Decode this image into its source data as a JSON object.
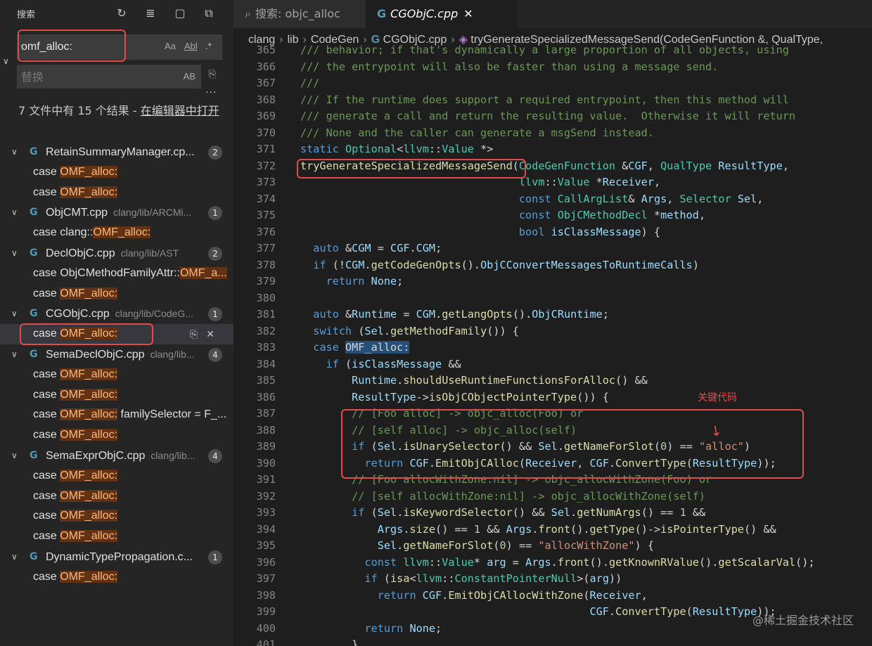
{
  "sidebar": {
    "title": "搜索",
    "search": {
      "value": "omf_alloc:",
      "opt_case": "Aa",
      "opt_word": "Abl",
      "opt_regex": ".*"
    },
    "replace": {
      "placeholder": "替换",
      "opt_preserve": "AB"
    },
    "summary": {
      "text": "7 文件中有 15 个结果 - ",
      "link": "在编辑器中打开"
    },
    "files": [
      {
        "name": "RetainSummaryManager.cp...",
        "path": "",
        "count": "2",
        "matches": [
          {
            "pre": "case ",
            "hit": "OMF_alloc:",
            "post": ""
          },
          {
            "pre": "case ",
            "hit": "OMF_alloc:",
            "post": ""
          }
        ]
      },
      {
        "name": "ObjCMT.cpp",
        "path": "clang/lib/ARCMi...",
        "count": "1",
        "matches": [
          {
            "pre": "case clang::",
            "hit": "OMF_alloc:",
            "post": ""
          }
        ]
      },
      {
        "name": "DeclObjC.cpp",
        "path": "clang/lib/AST",
        "count": "2",
        "matches": [
          {
            "pre": "case ObjCMethodFamilyAttr::",
            "hit": "OMF_a...",
            "post": ""
          },
          {
            "pre": "case ",
            "hit": "OMF_alloc:",
            "post": ""
          }
        ]
      },
      {
        "name": "CGObjC.cpp",
        "path": "clang/lib/CodeG...",
        "count": "1",
        "matches": [
          {
            "pre": "case ",
            "hit": "OMF_alloc:",
            "post": "",
            "selected": true
          }
        ]
      },
      {
        "name": "SemaDeclObjC.cpp",
        "path": "clang/lib...",
        "count": "4",
        "matches": [
          {
            "pre": "case ",
            "hit": "OMF_alloc:",
            "post": ""
          },
          {
            "pre": "case ",
            "hit": "OMF_alloc:",
            "post": ""
          },
          {
            "pre": "case ",
            "hit": "OMF_alloc:",
            "post": " familySelector = F_..."
          },
          {
            "pre": "case ",
            "hit": "OMF_alloc:",
            "post": ""
          }
        ]
      },
      {
        "name": "SemaExprObjC.cpp",
        "path": "clang/lib...",
        "count": "4",
        "matches": [
          {
            "pre": "case ",
            "hit": "OMF_alloc:",
            "post": ""
          },
          {
            "pre": "case ",
            "hit": "OMF_alloc:",
            "post": ""
          },
          {
            "pre": "case ",
            "hit": "OMF_alloc:",
            "post": ""
          },
          {
            "pre": "case ",
            "hit": "OMF_alloc:",
            "post": ""
          }
        ]
      },
      {
        "name": "DynamicTypePropagation.c...",
        "path": "",
        "count": "1",
        "matches": [
          {
            "pre": "case ",
            "hit": "OMF_alloc:",
            "post": ""
          }
        ]
      }
    ]
  },
  "tabs": {
    "search_tab": "搜索: objc_alloc",
    "file_tab": "CGObjC.cpp"
  },
  "breadcrumb": {
    "p1": "clang",
    "p2": "lib",
    "p3": "CodeGen",
    "p4": "CGObjC.cpp",
    "p5": "tryGenerateSpecializedMessageSend(CodeGenFunction &, QualType,"
  },
  "annotation": "关键代码",
  "watermark": "@稀土掘金技术社区",
  "code": [
    {
      "n": "365",
      "t": [
        [
          "c",
          "/// behavior; if that's dynamically a large proportion of all objects, using"
        ]
      ]
    },
    {
      "n": "366",
      "t": [
        [
          "c",
          "/// the entrypoint will also be faster than using a message send."
        ]
      ]
    },
    {
      "n": "367",
      "t": [
        [
          "c",
          "///"
        ]
      ]
    },
    {
      "n": "368",
      "t": [
        [
          "c",
          "/// If the runtime does support a required entrypoint, then this method will"
        ]
      ]
    },
    {
      "n": "369",
      "t": [
        [
          "c",
          "/// generate a call and return the resulting value.  Otherwise it will return"
        ]
      ]
    },
    {
      "n": "370",
      "t": [
        [
          "c",
          "/// None and the caller can generate a msgSend instead."
        ]
      ]
    },
    {
      "n": "371",
      "t": [
        [
          "k",
          "static "
        ],
        [
          "t",
          "Optional"
        ],
        [
          "p",
          "<"
        ],
        [
          "t",
          "llvm"
        ],
        [
          "p",
          "::"
        ],
        [
          "t",
          "Value"
        ],
        [
          "p",
          " *>"
        ]
      ]
    },
    {
      "n": "372",
      "t": [
        [
          "f",
          "tryGenerateSpecializedMessageSend"
        ],
        [
          "p",
          "("
        ],
        [
          "t",
          "CodeGenFunction"
        ],
        [
          "p",
          " &"
        ],
        [
          "v",
          "CGF"
        ],
        [
          "p",
          ", "
        ],
        [
          "t",
          "QualType"
        ],
        [
          "p",
          " "
        ],
        [
          "v",
          "ResultType"
        ],
        [
          "p",
          ","
        ]
      ]
    },
    {
      "n": "373",
      "t": [
        [
          "p",
          "                                  "
        ],
        [
          "t",
          "llvm"
        ],
        [
          "p",
          "::"
        ],
        [
          "t",
          "Value"
        ],
        [
          "p",
          " *"
        ],
        [
          "v",
          "Receiver"
        ],
        [
          "p",
          ","
        ]
      ]
    },
    {
      "n": "374",
      "t": [
        [
          "p",
          "                                  "
        ],
        [
          "k",
          "const "
        ],
        [
          "t",
          "CallArgList"
        ],
        [
          "p",
          "& "
        ],
        [
          "v",
          "Args"
        ],
        [
          "p",
          ", "
        ],
        [
          "t",
          "Selector"
        ],
        [
          "p",
          " "
        ],
        [
          "v",
          "Sel"
        ],
        [
          "p",
          ","
        ]
      ]
    },
    {
      "n": "375",
      "t": [
        [
          "p",
          "                                  "
        ],
        [
          "k",
          "const "
        ],
        [
          "t",
          "ObjCMethodDecl"
        ],
        [
          "p",
          " *"
        ],
        [
          "v",
          "method"
        ],
        [
          "p",
          ","
        ]
      ]
    },
    {
      "n": "376",
      "t": [
        [
          "p",
          "                                  "
        ],
        [
          "k",
          "bool "
        ],
        [
          "v",
          "isClassMessage"
        ],
        [
          "p",
          ") {"
        ]
      ]
    },
    {
      "n": "377",
      "t": [
        [
          "p",
          "  "
        ],
        [
          "k",
          "auto "
        ],
        [
          "p",
          "&"
        ],
        [
          "v",
          "CGM"
        ],
        [
          "p",
          " = "
        ],
        [
          "v",
          "CGF"
        ],
        [
          "p",
          "."
        ],
        [
          "v",
          "CGM"
        ],
        [
          "p",
          ";"
        ]
      ]
    },
    {
      "n": "378",
      "t": [
        [
          "p",
          "  "
        ],
        [
          "k",
          "if "
        ],
        [
          "p",
          "(!"
        ],
        [
          "v",
          "CGM"
        ],
        [
          "p",
          "."
        ],
        [
          "f",
          "getCodeGenOpts"
        ],
        [
          "p",
          "()."
        ],
        [
          "v",
          "ObjCConvertMessagesToRuntimeCalls"
        ],
        [
          "p",
          ")"
        ]
      ]
    },
    {
      "n": "379",
      "t": [
        [
          "p",
          "    "
        ],
        [
          "k",
          "return "
        ],
        [
          "v",
          "None"
        ],
        [
          "p",
          ";"
        ]
      ]
    },
    {
      "n": "380",
      "t": [
        [
          "p",
          ""
        ]
      ]
    },
    {
      "n": "381",
      "t": [
        [
          "p",
          "  "
        ],
        [
          "k",
          "auto "
        ],
        [
          "p",
          "&"
        ],
        [
          "v",
          "Runtime"
        ],
        [
          "p",
          " = "
        ],
        [
          "v",
          "CGM"
        ],
        [
          "p",
          "."
        ],
        [
          "f",
          "getLangOpts"
        ],
        [
          "p",
          "()."
        ],
        [
          "v",
          "ObjCRuntime"
        ],
        [
          "p",
          ";"
        ]
      ]
    },
    {
      "n": "382",
      "t": [
        [
          "p",
          "  "
        ],
        [
          "k",
          "switch "
        ],
        [
          "p",
          "("
        ],
        [
          "v",
          "Sel"
        ],
        [
          "p",
          "."
        ],
        [
          "f",
          "getMethodFamily"
        ],
        [
          "p",
          "()) {"
        ]
      ]
    },
    {
      "n": "383",
      "t": [
        [
          "p",
          "  "
        ],
        [
          "k",
          "case "
        ],
        [
          "hl",
          "OMF_alloc:"
        ]
      ]
    },
    {
      "n": "384",
      "t": [
        [
          "p",
          "    "
        ],
        [
          "k",
          "if "
        ],
        [
          "p",
          "("
        ],
        [
          "v",
          "isClassMessage"
        ],
        [
          "p",
          " &&"
        ]
      ]
    },
    {
      "n": "385",
      "t": [
        [
          "p",
          "        "
        ],
        [
          "v",
          "Runtime"
        ],
        [
          "p",
          "."
        ],
        [
          "f",
          "shouldUseRuntimeFunctionsForAlloc"
        ],
        [
          "p",
          "() &&"
        ]
      ]
    },
    {
      "n": "386",
      "t": [
        [
          "p",
          "        "
        ],
        [
          "v",
          "ResultType"
        ],
        [
          "p",
          "->"
        ],
        [
          "f",
          "isObjCObjectPointerType"
        ],
        [
          "p",
          "()) {"
        ]
      ]
    },
    {
      "n": "387",
      "t": [
        [
          "p",
          "        "
        ],
        [
          "c",
          "// [Foo alloc] -> objc_alloc(Foo) or"
        ]
      ]
    },
    {
      "n": "388",
      "t": [
        [
          "p",
          "        "
        ],
        [
          "c",
          "// [self alloc] -> objc_alloc(self)"
        ]
      ]
    },
    {
      "n": "389",
      "t": [
        [
          "p",
          "        "
        ],
        [
          "k",
          "if "
        ],
        [
          "p",
          "("
        ],
        [
          "v",
          "Sel"
        ],
        [
          "p",
          "."
        ],
        [
          "f",
          "isUnarySelector"
        ],
        [
          "p",
          "() && "
        ],
        [
          "v",
          "Sel"
        ],
        [
          "p",
          "."
        ],
        [
          "f",
          "getNameForSlot"
        ],
        [
          "p",
          "("
        ],
        [
          "n",
          "0"
        ],
        [
          "p",
          ") == "
        ],
        [
          "s",
          "\"alloc\""
        ],
        [
          "p",
          ")"
        ]
      ]
    },
    {
      "n": "390",
      "t": [
        [
          "p",
          "          "
        ],
        [
          "k",
          "return "
        ],
        [
          "v",
          "CGF"
        ],
        [
          "p",
          "."
        ],
        [
          "f",
          "EmitObjCAlloc"
        ],
        [
          "p",
          "("
        ],
        [
          "v",
          "Receiver"
        ],
        [
          "p",
          ", "
        ],
        [
          "v",
          "CGF"
        ],
        [
          "p",
          "."
        ],
        [
          "f",
          "ConvertType"
        ],
        [
          "p",
          "("
        ],
        [
          "v",
          "ResultType"
        ],
        [
          "p",
          "));"
        ]
      ]
    },
    {
      "n": "391",
      "t": [
        [
          "p",
          "        "
        ],
        [
          "c",
          "// [Foo allocWithZone:nil] -> objc_allocWithZone(Foo) or"
        ]
      ]
    },
    {
      "n": "392",
      "t": [
        [
          "p",
          "        "
        ],
        [
          "c",
          "// [self allocWithZone:nil] -> objc_allocWithZone(self)"
        ]
      ]
    },
    {
      "n": "393",
      "t": [
        [
          "p",
          "        "
        ],
        [
          "k",
          "if "
        ],
        [
          "p",
          "("
        ],
        [
          "v",
          "Sel"
        ],
        [
          "p",
          "."
        ],
        [
          "f",
          "isKeywordSelector"
        ],
        [
          "p",
          "() && "
        ],
        [
          "v",
          "Sel"
        ],
        [
          "p",
          "."
        ],
        [
          "f",
          "getNumArgs"
        ],
        [
          "p",
          "() == "
        ],
        [
          "n",
          "1"
        ],
        [
          "p",
          " &&"
        ]
      ]
    },
    {
      "n": "394",
      "t": [
        [
          "p",
          "            "
        ],
        [
          "v",
          "Args"
        ],
        [
          "p",
          "."
        ],
        [
          "f",
          "size"
        ],
        [
          "p",
          "() == "
        ],
        [
          "n",
          "1"
        ],
        [
          "p",
          " && "
        ],
        [
          "v",
          "Args"
        ],
        [
          "p",
          "."
        ],
        [
          "f",
          "front"
        ],
        [
          "p",
          "()."
        ],
        [
          "f",
          "getType"
        ],
        [
          "p",
          "()->"
        ],
        [
          "f",
          "isPointerType"
        ],
        [
          "p",
          "() &&"
        ]
      ]
    },
    {
      "n": "395",
      "t": [
        [
          "p",
          "            "
        ],
        [
          "v",
          "Sel"
        ],
        [
          "p",
          "."
        ],
        [
          "f",
          "getNameForSlot"
        ],
        [
          "p",
          "("
        ],
        [
          "n",
          "0"
        ],
        [
          "p",
          ") == "
        ],
        [
          "s",
          "\"allocWithZone\""
        ],
        [
          "p",
          ") {"
        ]
      ]
    },
    {
      "n": "396",
      "t": [
        [
          "p",
          "          "
        ],
        [
          "k",
          "const "
        ],
        [
          "t",
          "llvm"
        ],
        [
          "p",
          "::"
        ],
        [
          "t",
          "Value"
        ],
        [
          "p",
          "* "
        ],
        [
          "v",
          "arg"
        ],
        [
          "p",
          " = "
        ],
        [
          "v",
          "Args"
        ],
        [
          "p",
          "."
        ],
        [
          "f",
          "front"
        ],
        [
          "p",
          "()."
        ],
        [
          "f",
          "getKnownRValue"
        ],
        [
          "p",
          "()."
        ],
        [
          "f",
          "getScalarVal"
        ],
        [
          "p",
          "();"
        ]
      ]
    },
    {
      "n": "397",
      "t": [
        [
          "p",
          "          "
        ],
        [
          "k",
          "if "
        ],
        [
          "p",
          "("
        ],
        [
          "f",
          "isa"
        ],
        [
          "p",
          "<"
        ],
        [
          "t",
          "llvm"
        ],
        [
          "p",
          "::"
        ],
        [
          "t",
          "ConstantPointerNull"
        ],
        [
          "p",
          ">("
        ],
        [
          "v",
          "arg"
        ],
        [
          "p",
          "))"
        ]
      ]
    },
    {
      "n": "398",
      "t": [
        [
          "p",
          "            "
        ],
        [
          "k",
          "return "
        ],
        [
          "v",
          "CGF"
        ],
        [
          "p",
          "."
        ],
        [
          "f",
          "EmitObjCAllocWithZone"
        ],
        [
          "p",
          "("
        ],
        [
          "v",
          "Receiver"
        ],
        [
          "p",
          ","
        ]
      ]
    },
    {
      "n": "399",
      "t": [
        [
          "p",
          "                                             "
        ],
        [
          "v",
          "CGF"
        ],
        [
          "p",
          "."
        ],
        [
          "f",
          "ConvertType"
        ],
        [
          "p",
          "("
        ],
        [
          "v",
          "ResultType"
        ],
        [
          "p",
          "));"
        ]
      ]
    },
    {
      "n": "400",
      "t": [
        [
          "p",
          "          "
        ],
        [
          "k",
          "return "
        ],
        [
          "v",
          "None"
        ],
        [
          "p",
          ";"
        ]
      ]
    },
    {
      "n": "401",
      "t": [
        [
          "p",
          "        }"
        ]
      ]
    }
  ]
}
